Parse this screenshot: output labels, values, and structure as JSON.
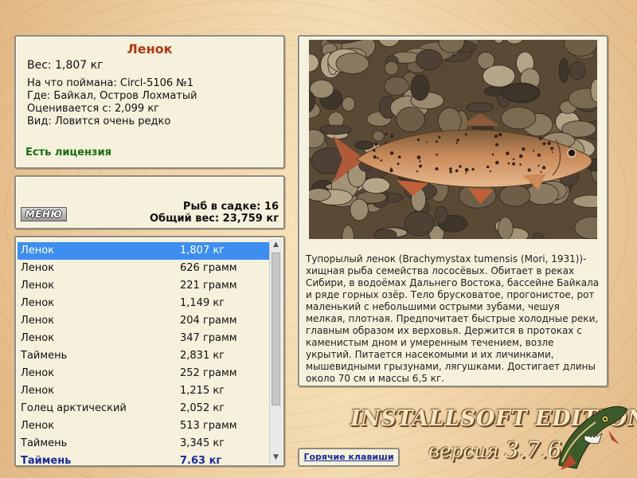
{
  "fish": {
    "name": "Ленок",
    "weight": "Вес: 1,807 кг",
    "bait": "На что поймана: Circl-5106 №1",
    "where": "Где: Байкал, Остров Лохматый",
    "valued": "Оценивается с: 2,099 кг",
    "kind": "Вид: Ловится очень редко",
    "license": "Есть лицензия"
  },
  "summary": {
    "menu_label": "МЕНЮ",
    "count_label": "Рыб в садке: 16",
    "total_label": "Общий вес: 23,759 кг"
  },
  "catch_list": {
    "rows": [
      {
        "name": "Ленок",
        "weight": "1,807 кг"
      },
      {
        "name": "Ленок",
        "weight": "626 грамм"
      },
      {
        "name": "Ленок",
        "weight": "221 грамм"
      },
      {
        "name": "Ленок",
        "weight": "1,149 кг"
      },
      {
        "name": "Ленок",
        "weight": "204 грамм"
      },
      {
        "name": "Ленок",
        "weight": "347 грамм"
      },
      {
        "name": "Таймень",
        "weight": "2,831 кг"
      },
      {
        "name": "Ленок",
        "weight": "252 грамм"
      },
      {
        "name": "Ленок",
        "weight": "1,215 кг"
      },
      {
        "name": "Голец арктический",
        "weight": "2,052 кг"
      },
      {
        "name": "Ленок",
        "weight": "513 грамм"
      },
      {
        "name": "Таймень",
        "weight": "3,345 кг"
      },
      {
        "name": "Таймень",
        "weight": "7.63 кг"
      }
    ],
    "selected_index": 0,
    "current_index": 12,
    "scroll_position": 0.0
  },
  "detail": {
    "description": "Тупорылый ленок (Brachymystax tumensis (Mori, 1931))- хищная рыба семейства лососёвых. Обитает в реках Сибири, в водоёмах Дальнего Востока, бассейне Байкала и ряде горных озёр. Тело брусковатое, прогонистое, рот маленький с небольшими острыми зубами, чешуя мелкая, плотная. Предпочитает быстрые холодные реки, главным образом их верховья. Держится в протоках с каменистым дном и умеренным течением, возле укрытий. Питается насекомыми и их личинками, мышевидными грызунами, лягушками. Достигает длины около 70 см и массы 6,5 кг."
  },
  "hotkeys_label": "Горячие клавиши",
  "branding": {
    "title": "INSTALLSOFT EDITION",
    "version_word": "версия",
    "version_number": "3.7.6"
  },
  "icons": {
    "scroll_up": "triangle-up",
    "scroll_down": "triangle-down"
  },
  "colors": {
    "panel_bg": "#f5f1dd",
    "fish_name": "#b03a10",
    "license": "#1d6b16",
    "selected_row": "#3d8ef0",
    "link": "#1a2b9a"
  }
}
